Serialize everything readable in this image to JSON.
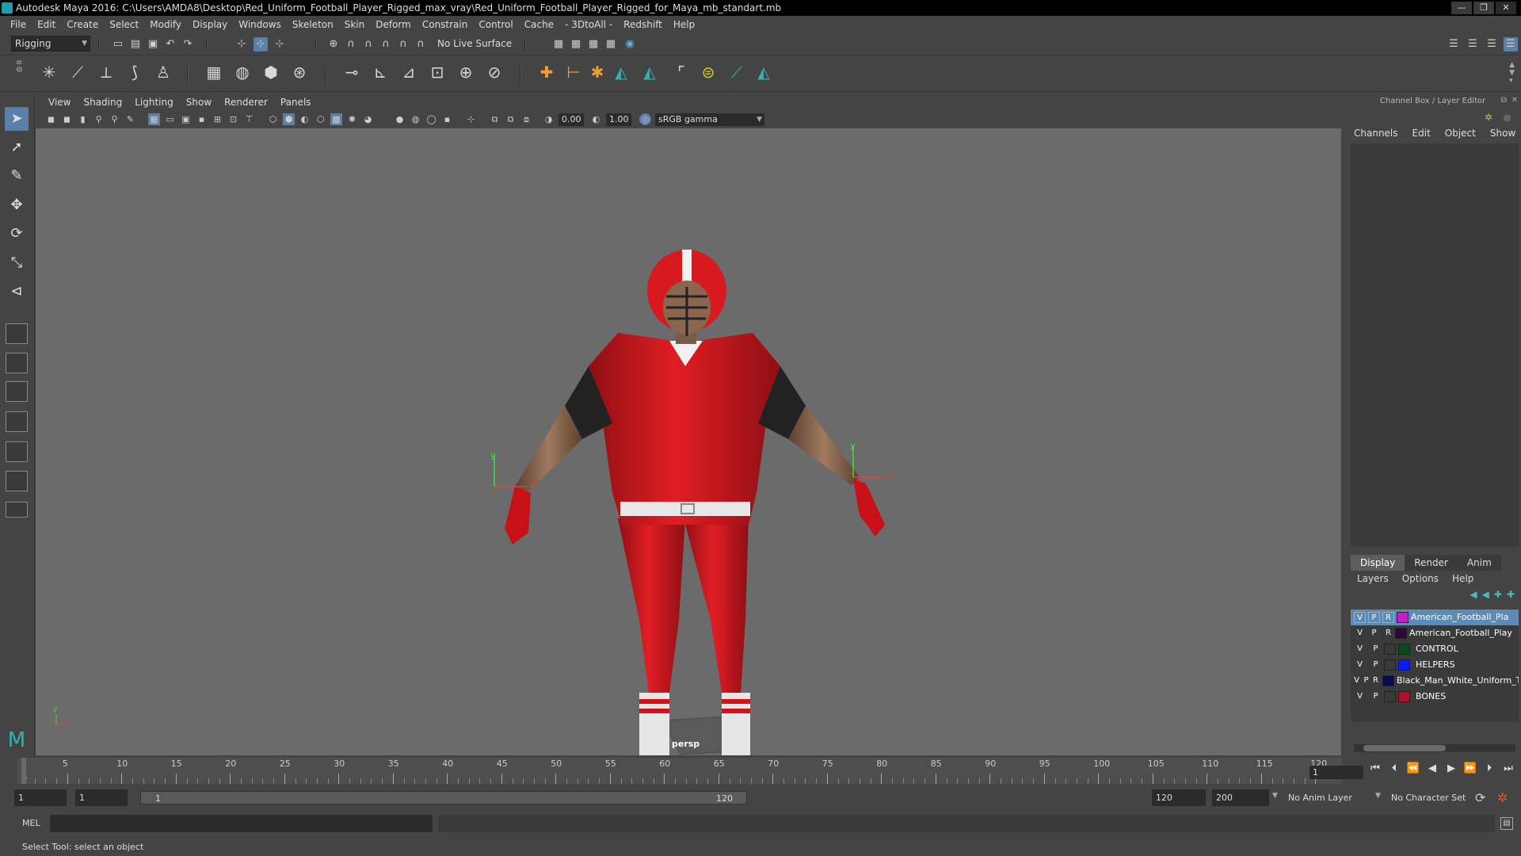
{
  "window": {
    "title": "Autodesk Maya 2016: C:\\Users\\AMDA8\\Desktop\\Red_Uniform_Football_Player_Rigged_max_vray\\Red_Uniform_Football_Player_Rigged_for_Maya_mb_standart.mb",
    "minimize": "—",
    "maximize": "❐",
    "close": "✕"
  },
  "menubar": [
    "File",
    "Edit",
    "Create",
    "Select",
    "Modify",
    "Display",
    "Windows",
    "Skeleton",
    "Skin",
    "Deform",
    "Constrain",
    "Control",
    "Cache",
    "- 3DtoAll -",
    "Redshift",
    "Help"
  ],
  "statusline": {
    "menuset": "Rigging",
    "live_surface": "No Live Surface"
  },
  "viewport": {
    "menu": [
      "View",
      "Shading",
      "Lighting",
      "Show",
      "Renderer",
      "Panels"
    ],
    "exposure": "0.00",
    "gamma": "1.00",
    "color_space": "sRGB gamma",
    "camera_label": "persp",
    "axis_x": "x",
    "axis_y": "y",
    "axis_z": "z"
  },
  "channel_box": {
    "title": "Channel Box / Layer Editor",
    "menu": [
      "Channels",
      "Edit",
      "Object",
      "Show"
    ]
  },
  "layer_editor": {
    "tabs": [
      "Display",
      "Render",
      "Anim"
    ],
    "active_tab": "Display",
    "menu": [
      "Layers",
      "Options",
      "Help"
    ],
    "layers": [
      {
        "v": "V",
        "p": "P",
        "r": "R",
        "color": "#c81ec8",
        "name": "American_Football_Pla",
        "selected": true
      },
      {
        "v": "V",
        "p": "P",
        "r": "R",
        "color": "#2a0a3a",
        "name": "American_Football_Play",
        "selected": false
      },
      {
        "v": "V",
        "p": "P",
        "r": "",
        "color": "#0a4a1a",
        "name": "CONTROL",
        "selected": false
      },
      {
        "v": "V",
        "p": "P",
        "r": "",
        "color": "#0a1aff",
        "name": "HELPERS",
        "selected": false
      },
      {
        "v": "V",
        "p": "P",
        "r": "R",
        "color": "#0a0a50",
        "name": "Black_Man_White_Uniform_T",
        "selected": false
      },
      {
        "v": "V",
        "p": "P",
        "r": "",
        "color": "#b01030",
        "name": "BONES",
        "selected": false
      }
    ]
  },
  "timeline": {
    "ticks": [
      "5",
      "10",
      "15",
      "20",
      "25",
      "30",
      "35",
      "40",
      "45",
      "50",
      "55",
      "60",
      "65",
      "70",
      "75",
      "80",
      "85",
      "90",
      "95",
      "100",
      "105",
      "110",
      "115",
      "120"
    ],
    "first_tick": "1",
    "current_frame": "1"
  },
  "range": {
    "start": "1",
    "inner_start": "1",
    "slider_start": "1",
    "slider_end": "120",
    "end": "120",
    "max_end": "200",
    "anim_layer": "No Anim Layer",
    "character_set": "No Character Set"
  },
  "cmdline": {
    "label": "MEL"
  },
  "helpline": {
    "text": "Select Tool: select an object"
  }
}
